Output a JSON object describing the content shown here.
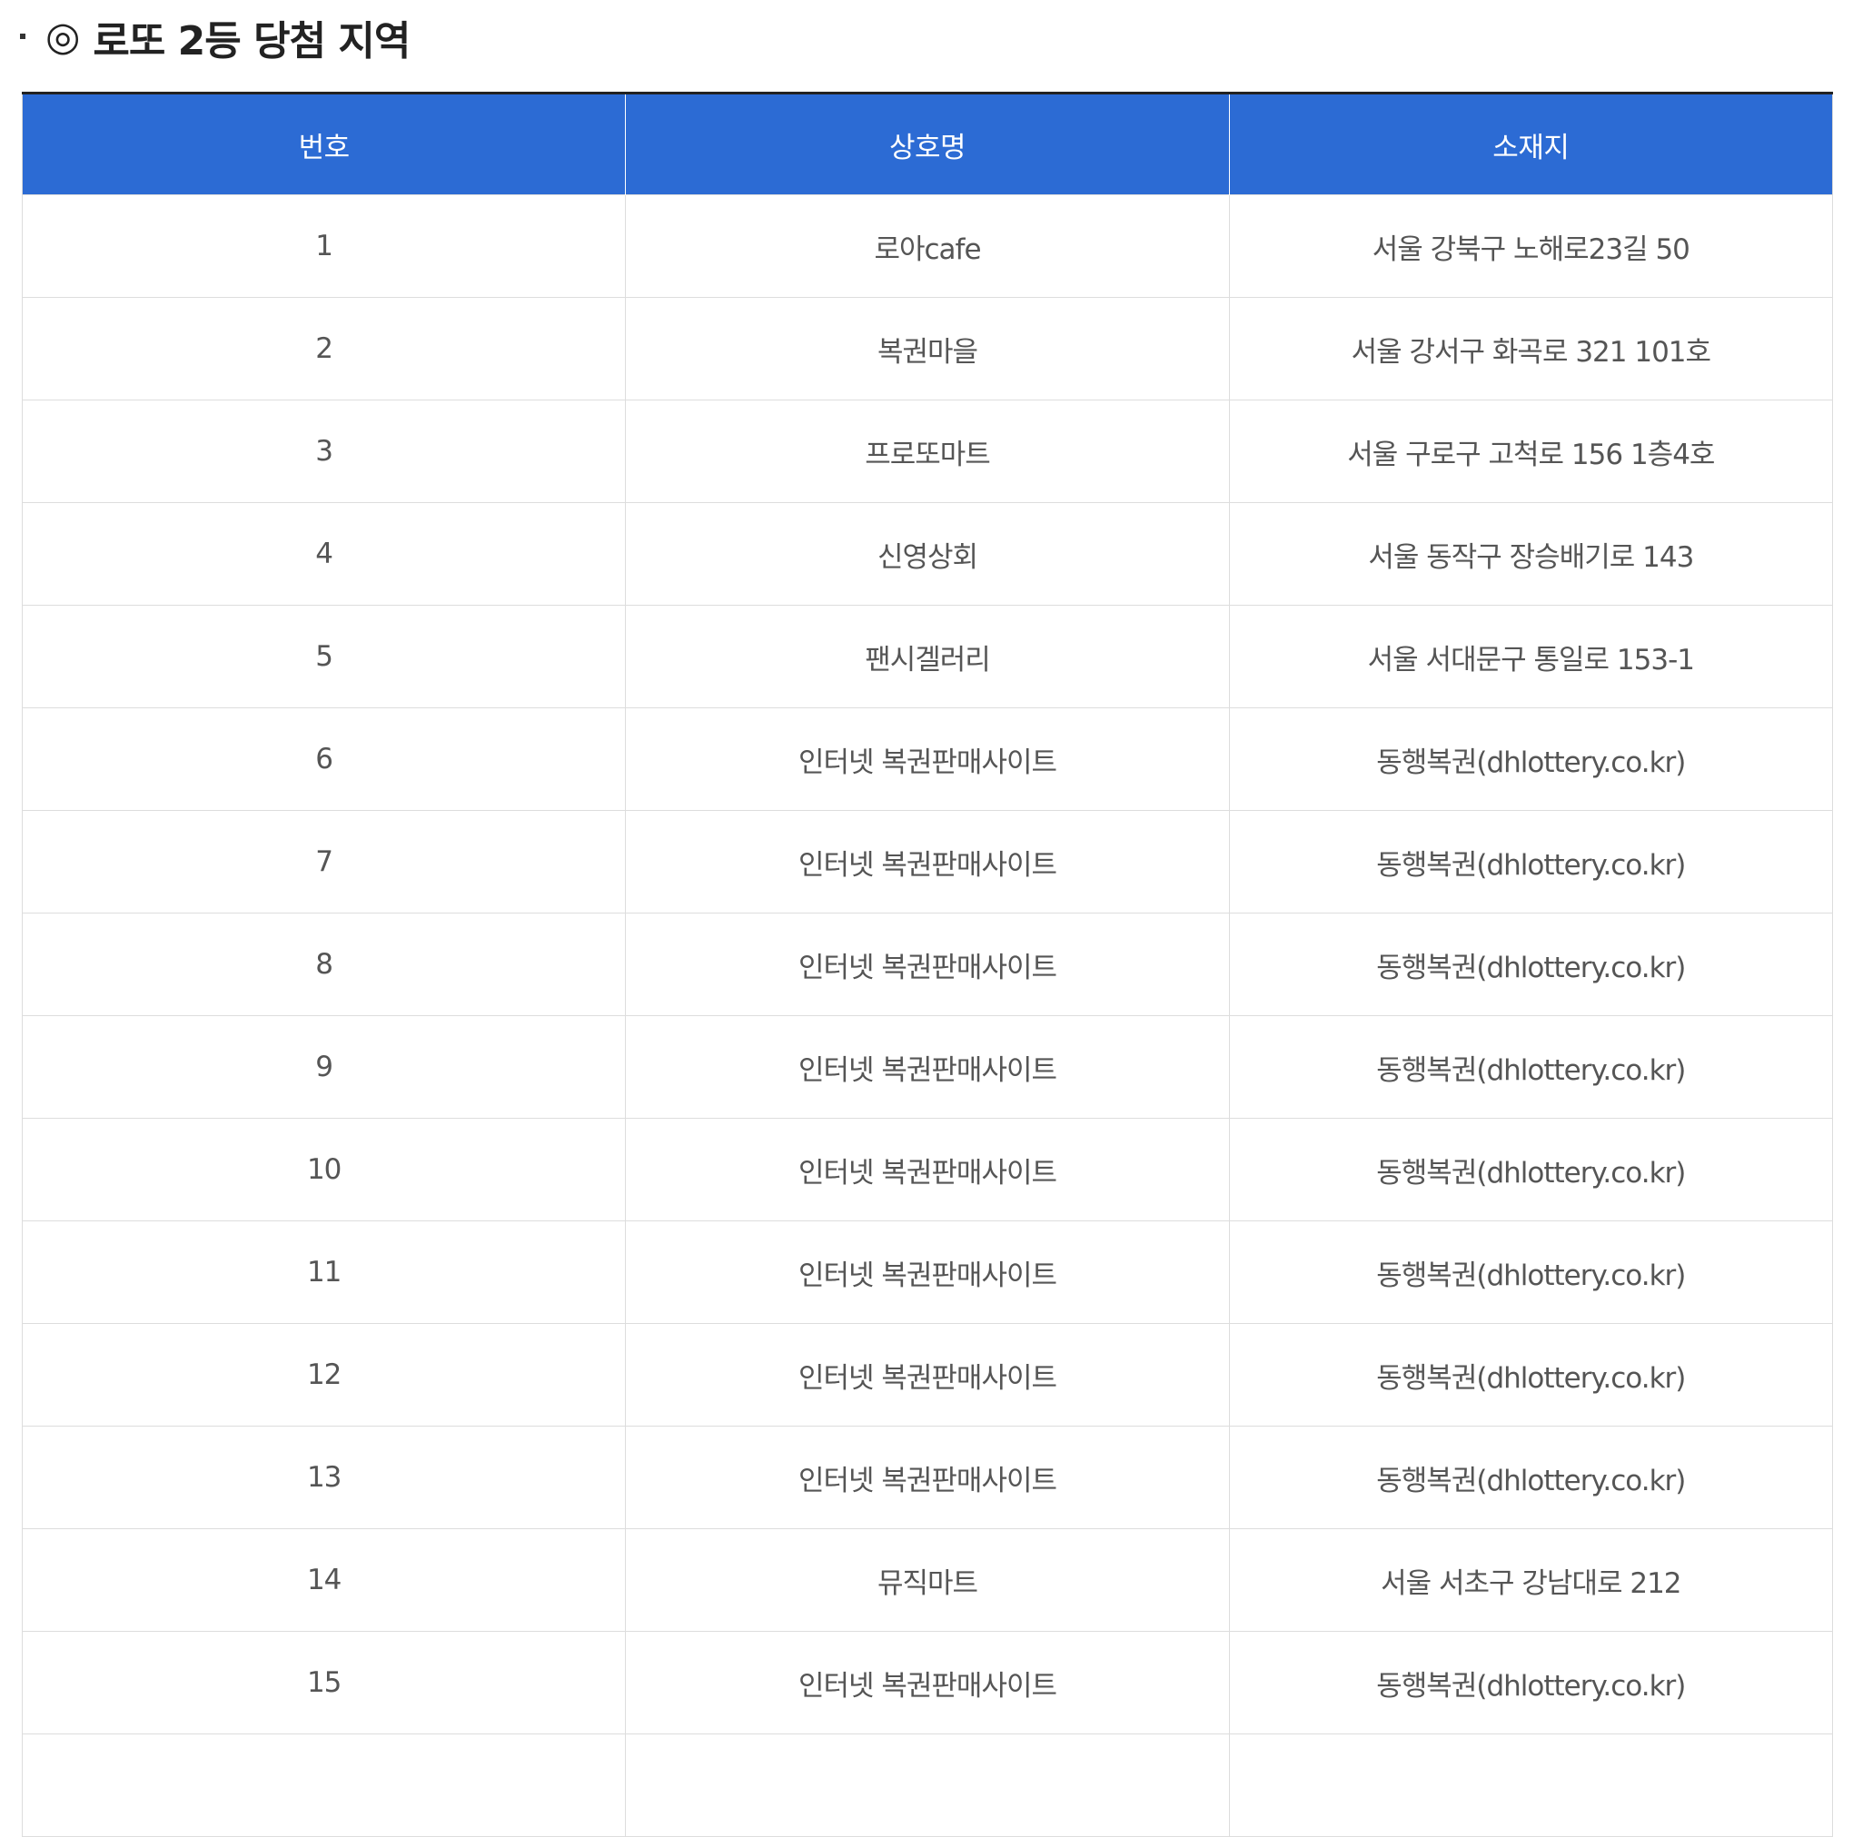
{
  "section": {
    "bullet": "·",
    "mark": "◎",
    "title": "로또 2등 당첨 지역"
  },
  "table": {
    "headers": [
      "번호",
      "상호명",
      "소재지"
    ],
    "rows": [
      {
        "no": "1",
        "name": "로아cafe",
        "address": "서울 강북구 노해로23길 50"
      },
      {
        "no": "2",
        "name": "복권마을",
        "address": "서울 강서구 화곡로 321 101호"
      },
      {
        "no": "3",
        "name": "프로또마트",
        "address": "서울 구로구 고척로 156 1층4호"
      },
      {
        "no": "4",
        "name": "신영상회",
        "address": "서울 동작구 장승배기로 143"
      },
      {
        "no": "5",
        "name": "팬시겔러리",
        "address": "서울 서대문구 통일로 153-1"
      },
      {
        "no": "6",
        "name": "인터넷 복권판매사이트",
        "address": "동행복권(dhlottery.co.kr)"
      },
      {
        "no": "7",
        "name": "인터넷 복권판매사이트",
        "address": "동행복권(dhlottery.co.kr)"
      },
      {
        "no": "8",
        "name": "인터넷 복권판매사이트",
        "address": "동행복권(dhlottery.co.kr)"
      },
      {
        "no": "9",
        "name": "인터넷 복권판매사이트",
        "address": "동행복권(dhlottery.co.kr)"
      },
      {
        "no": "10",
        "name": "인터넷 복권판매사이트",
        "address": "동행복권(dhlottery.co.kr)"
      },
      {
        "no": "11",
        "name": "인터넷 복권판매사이트",
        "address": "동행복권(dhlottery.co.kr)"
      },
      {
        "no": "12",
        "name": "인터넷 복권판매사이트",
        "address": "동행복권(dhlottery.co.kr)"
      },
      {
        "no": "13",
        "name": "인터넷 복권판매사이트",
        "address": "동행복권(dhlottery.co.kr)"
      },
      {
        "no": "14",
        "name": "뮤직마트",
        "address": "서울 서초구 강남대로 212"
      },
      {
        "no": "15",
        "name": "인터넷 복권판매사이트",
        "address": "동행복권(dhlottery.co.kr)"
      },
      {
        "no": "",
        "name": "",
        "address": ""
      }
    ]
  },
  "colors": {
    "header_bg": "#2c6bd4",
    "header_text": "#ffffff",
    "cell_text": "#555555",
    "border": "#dddddd",
    "top_rule": "#222222"
  }
}
